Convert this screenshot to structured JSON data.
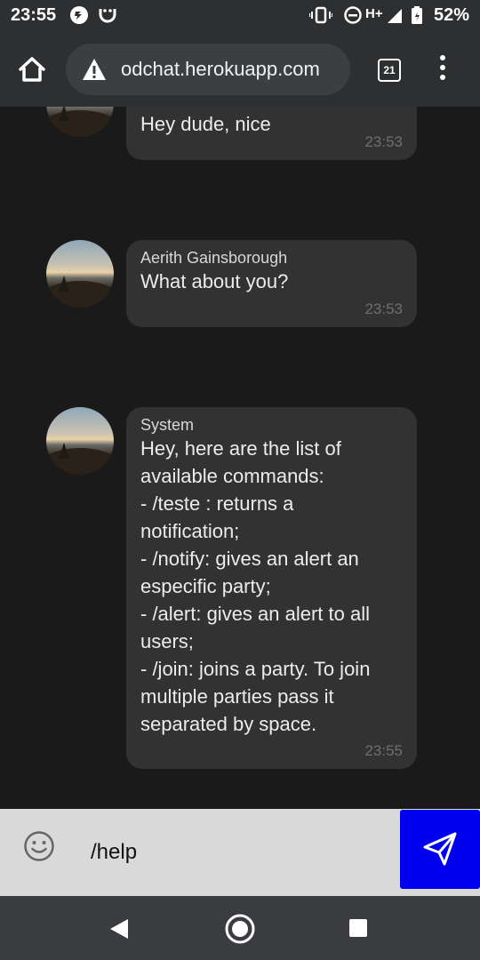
{
  "status_bar": {
    "time": "23:55",
    "battery_percent": "52%",
    "network": "H+",
    "icons": [
      "firefox-icon",
      "smile-notification-icon",
      "vibrate-icon",
      "dnd-icon",
      "signal-icon",
      "battery-icon"
    ]
  },
  "browser": {
    "url": "odchat.herokuapp.com",
    "tab_count": "21"
  },
  "messages": [
    {
      "sender": "",
      "text": "Hey dude, nice",
      "time": "23:53"
    },
    {
      "sender": "Aerith Gainsborough",
      "text": "What about you?",
      "time": "23:53"
    },
    {
      "sender": "System",
      "lines": [
        "Hey, here are the list of",
        "available commands:",
        "- /teste : returns a",
        "notification;",
        "- /notify: gives an alert an",
        "especific party;",
        "- /alert: gives an alert to all",
        "users;",
        "- /join: joins a party. To join",
        "multiple parties pass it",
        "separated by space."
      ],
      "time": "23:55"
    }
  ],
  "composer": {
    "value": "/help"
  },
  "colors": {
    "send_button": "#0000ee",
    "bubble": "#323232",
    "background": "#1a1a1a"
  }
}
